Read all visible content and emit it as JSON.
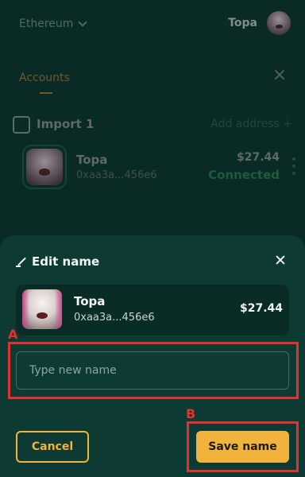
{
  "background": {
    "network": "Ethereum",
    "account_name": "Topa",
    "tab_accounts": "Accounts",
    "import_label": "Import 1",
    "add_address": "Add address",
    "row": {
      "name": "Topa",
      "address": "0xaa3a...456e6",
      "balance": "$27.44",
      "status": "Connected"
    }
  },
  "modal": {
    "title": "Edit name",
    "account": {
      "name": "Topa",
      "address": "0xaa3a...456e6",
      "balance": "$27.44"
    },
    "input_placeholder": "Type new name",
    "input_value": "",
    "cancel_label": "Cancel",
    "save_label": "Save name"
  },
  "annotations": {
    "marker_a": "A",
    "marker_b": "B"
  },
  "colors": {
    "accent": "#f2b33d",
    "annotation": "#e5302d",
    "sheet_bg": "#0d3a33"
  },
  "icons": [
    "chevron-down-icon",
    "close-icon",
    "import-icon",
    "plus-icon",
    "kebab-menu-icon",
    "edit-icon"
  ]
}
